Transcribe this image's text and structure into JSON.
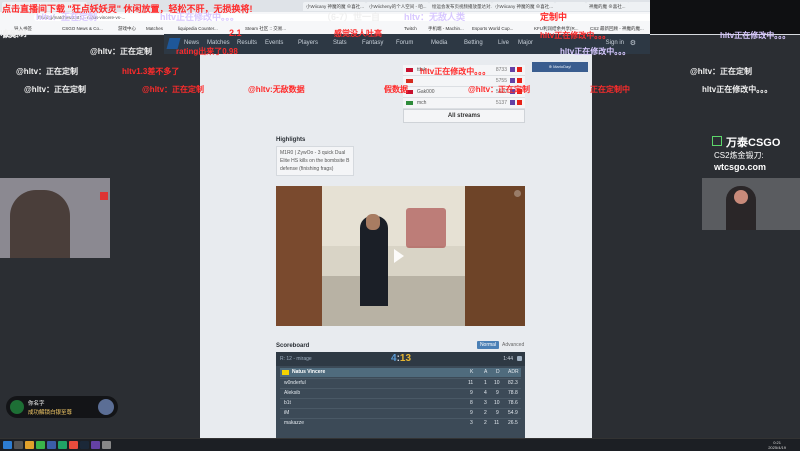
{
  "browser": {
    "tabs": [
      "",
      "",
      "",
      "小Wiicany 神魔的魔 ⊕喜社...",
      "小Wiicheny的个人空间 - 咱...",
      "绘运会发布页视频播放量达对...",
      "小Wiicany 神魔的魔 ⊕喜社...",
      "",
      "神魔的魔 ⊕喜社...",
      ""
    ],
    "url": "hltv.org/matches/2381... natus-vincere-vs-...",
    "bookmarks": [
      "导入书签",
      "CSGO News & Co...",
      "游戏中心",
      "Matches",
      "liquipedia Counter...",
      "Steam 社区 :: 交易...",
      "Twitch",
      "手机端 - Machin...",
      "Esports World Cup...",
      "KFU利润结余共享(R...",
      "CS2 最新回顾 - 神魔的魔..."
    ]
  },
  "hltv": {
    "nav": [
      "News",
      "Matches",
      "Results",
      "Events",
      "Players",
      "Stats",
      "Fantasy",
      "Forum",
      "Media",
      "Betting",
      "Live",
      "Major"
    ],
    "sign_in": "Sign in",
    "ad": "⊕ MarioDay!"
  },
  "streams": {
    "rows": [
      {
        "name": "ttlek",
        "count": "8733"
      },
      {
        "name": "",
        "count": "5755"
      },
      {
        "name": "Gak000",
        "count": "5620"
      },
      {
        "name": "mch",
        "count": "5137"
      }
    ],
    "all_label": "All streams"
  },
  "highlights": {
    "title": "Highlights",
    "text": "M1R0 | ZywOo - 3 quick Dual Elite HS kills on the bombsite B defense (finishing frags)"
  },
  "scoreboard": {
    "title": "Scoreboard",
    "normal": "Normal",
    "advanced": "Advanced",
    "round": "R: 12 - mirage",
    "score_ct": "4",
    "score_sep": ":",
    "score_t": "13",
    "timer": "1:44",
    "team": {
      "name": "Natus Vincere",
      "k": "K",
      "a": "A",
      "d": "D",
      "adr": "ADR"
    },
    "players": [
      {
        "name": "w0nderful",
        "k": "11",
        "a": "1",
        "d": "10",
        "adr": "82.3"
      },
      {
        "name": "Aleksib",
        "k": "9",
        "a": "4",
        "d": "9",
        "adr": "78.8"
      },
      {
        "name": "b1t",
        "k": "8",
        "a": "3",
        "d": "10",
        "adr": "78.6"
      },
      {
        "name": "iM",
        "k": "9",
        "a": "2",
        "d": "9",
        "adr": "54.9"
      },
      {
        "name": "makazze",
        "k": "3",
        "a": "2",
        "d": "11",
        "adr": "26.5"
      }
    ]
  },
  "overlays": {
    "top_banner": "点击直播间下载 \"狂点妖妖灵\" 休闲放置，轻松不肝，无损换将!",
    "o1": "像美！",
    "o2": "hltv：正在定制",
    "o3": "hltv正在修改中。。。",
    "o4": "2.1",
    "o5": "（6-7）世一自",
    "o6": "hltv：无敌人类",
    "o7": "定制中",
    "o8": "!在定制",
    "o9": "@hltv：正在定制",
    "o10": "rating出来了0.98",
    "o11": "感觉没人吐高",
    "o12": "hltv正在修改中。。。",
    "o13": "@hltv：正在定制",
    "o14": "hltv1.3差不多了",
    "o15": "hltv正在修改中。。。",
    "o16": "@hltv：正在定制",
    "o17": "@hltv：正在定制",
    "o18": "@hltv：正在定制",
    "o19": "@hltv:无敌数据",
    "o20": "假数据",
    "o21": "@hltv：正在定制",
    "o22": "正在定制中",
    "o23": "hltv正在修改中。。。",
    "o24": "hltv正在修改中。。。",
    "o25": "hltv正在修改中。。。"
  },
  "brand": {
    "name": "万泰CSGO",
    "sub": "CS2炼金锻刀:",
    "url": "wtcsgo.com"
  },
  "notification": {
    "user": "你名字",
    "msg": "成功解锁白银至尊"
  },
  "taskbar": {
    "time": "0:21",
    "date": "2025/4/19"
  },
  "colors": {
    "ct": "#5b9bd5",
    "t": "#e5b532",
    "overlay_red": "#ff2b2b"
  }
}
